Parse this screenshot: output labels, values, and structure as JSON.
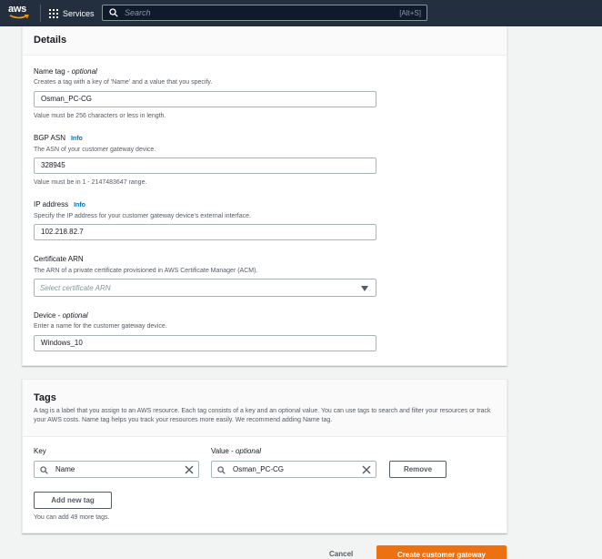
{
  "topnav": {
    "logo_text": "aws",
    "services_label": "Services",
    "search_placeholder": "Search",
    "search_shortcut": "[Alt+S]"
  },
  "details": {
    "title": "Details",
    "name_tag": {
      "label": "Name tag - ",
      "optional": "optional",
      "description": "Creates a tag with a key of 'Name' and a value that you specify.",
      "value": "Osman_PC-CG",
      "hint": "Value must be 256 characters or less in length."
    },
    "bgp_asn": {
      "label": "BGP ASN",
      "info": "Info",
      "description": "The ASN of your customer gateway device.",
      "value": "328945",
      "hint": "Value must be in 1 - 2147483647 range."
    },
    "ip_address": {
      "label": "IP address",
      "info": "Info",
      "description": "Specify the IP address for your customer gateway device's external interface.",
      "value": "102.218.82.7"
    },
    "certificate_arn": {
      "label": "Certificate ARN",
      "description": "The ARN of a private certificate provisioned in AWS Certificate Manager (ACM).",
      "placeholder": "Select certificate ARN"
    },
    "device": {
      "label": "Device - ",
      "optional": "optional",
      "description": "Enter a name for the customer gateway device.",
      "value": "Windows_10"
    }
  },
  "tags": {
    "title": "Tags",
    "description": "A tag is a label that you assign to an AWS resource. Each tag consists of a key and an optional value. You can use tags to search and filter your resources or track your AWS costs. Name tag helps you track your resources more easily. We recommend adding Name tag.",
    "key_label": "Key",
    "value_label": "Value - ",
    "value_optional": "optional",
    "rows": [
      {
        "key": "Name",
        "value": "Osman_PC-CG"
      }
    ],
    "remove_label": "Remove",
    "add_label": "Add new tag",
    "remaining": "You can add 49 more tags."
  },
  "footer": {
    "cancel_label": "Cancel",
    "create_label": "Create customer gateway"
  },
  "colors": {
    "nav_bg": "#232f3e",
    "primary": "#ec7211",
    "link": "#0073bb"
  }
}
